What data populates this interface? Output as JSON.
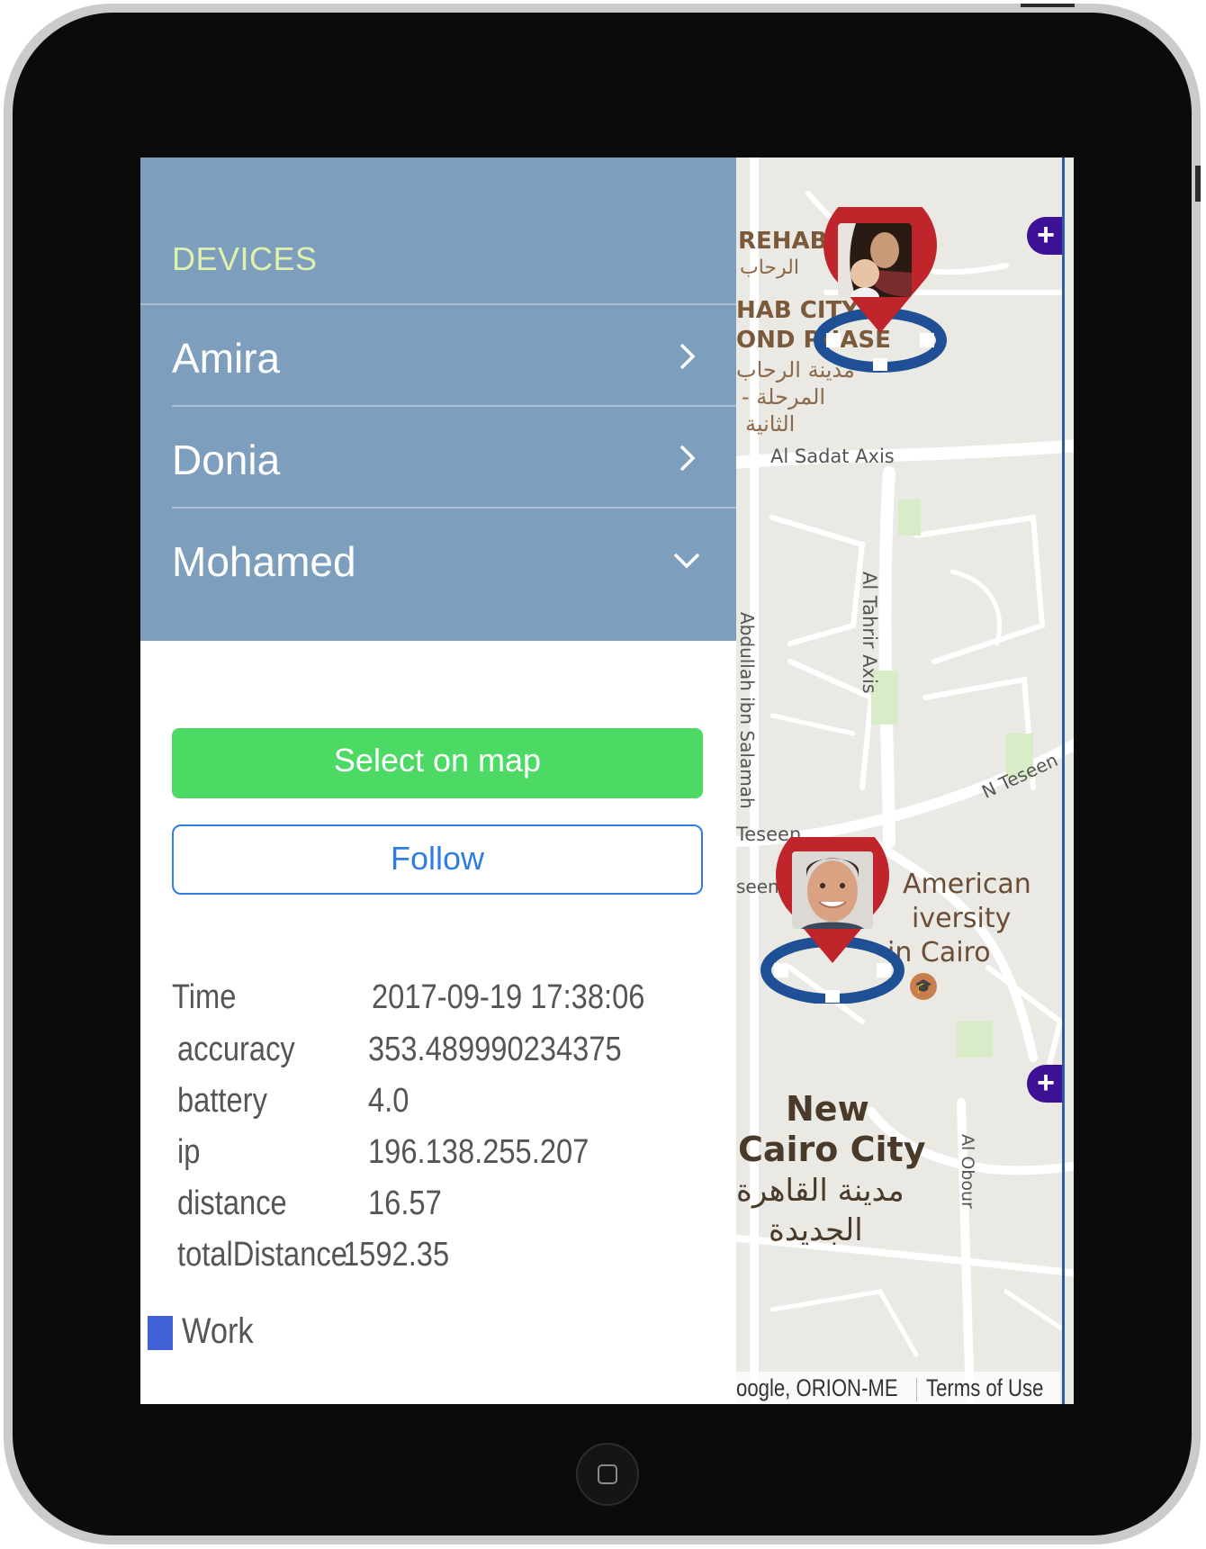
{
  "sidebar": {
    "title": "DEVICES",
    "devices": [
      {
        "name": "Amira",
        "state": "collapsed"
      },
      {
        "name": "Donia",
        "state": "collapsed"
      },
      {
        "name": "Mohamed",
        "state": "expanded"
      }
    ],
    "select_on_map_label": "Select on map",
    "follow_label": "Follow",
    "info": {
      "time_label": "Time",
      "time_value": "2017-09-19 17:38:06",
      "accuracy_label": "accuracy",
      "accuracy_value": "353.489990234375",
      "battery_label": "battery",
      "battery_value": "4.0",
      "ip_label": "ip",
      "ip_value": "196.138.255.207",
      "distance_label": "distance",
      "distance_value": "16.57",
      "total_distance_label": "totalDistance",
      "total_distance_value": "1592.35"
    },
    "legend": {
      "label": "Work",
      "color": "#4260d8"
    }
  },
  "map": {
    "labels": {
      "rehab": "REHAB",
      "rehab_ar": "الرحاب",
      "rehab_city": "HAB CITY",
      "second_phase": "OND PHASE",
      "rehab_ar_2": "مدينة الرحاب",
      "rehab_ar_3": "- المرحلة",
      "rehab_ar_4": "الثانية",
      "sadat_axis": "Al Sadat Axis",
      "tahrir_axis": "Al Tahrir Axis",
      "abdullah": "Abdullah ibn Salamah",
      "n_teseen": "N Teseen",
      "teseen": "Teseen",
      "seen": "seen",
      "american": "American",
      "university": "iversity",
      "in_cairo": "in Cairo",
      "new": "New",
      "cairo_city": "Cairo City",
      "new_cairo_ar_1": "مدينة القاهرة",
      "new_cairo_ar_2": "الجديدة",
      "al_obour": "Al Obour"
    },
    "attribution": "oogle, ORION-ME",
    "terms": "Terms of Use",
    "zoom_in_label": "+",
    "markers": [
      {
        "name": "woman-with-baby"
      },
      {
        "name": "man"
      }
    ]
  },
  "colors": {
    "nav_bg": "#7d9fbd",
    "title_color": "#e0f0ad",
    "select_btn": "#4cd964",
    "follow_btn": "#2f7de1",
    "pin_red": "#c0252b",
    "pin_ring": "#1f4f94",
    "zoom_btn": "#3d1196"
  }
}
